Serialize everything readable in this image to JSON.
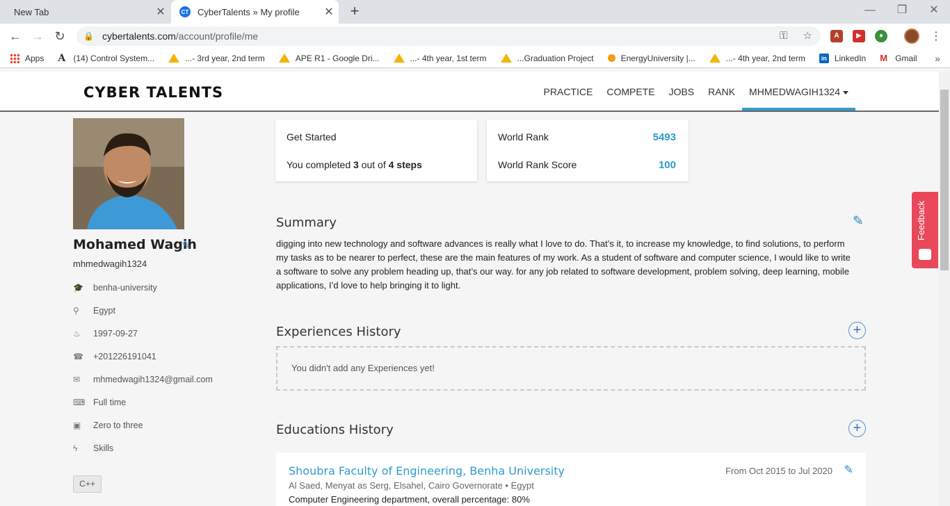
{
  "browser": {
    "tabs": [
      {
        "title": "New Tab"
      },
      {
        "title": "CyberTalents » My profile",
        "favicon": "CT"
      }
    ],
    "url": {
      "host": "cybertalents.com",
      "path": "/account/profile/me"
    },
    "bookmarks": [
      {
        "label": "Apps",
        "icon": "apps-grid-icon"
      },
      {
        "label": "(14) Control System...",
        "icon": "font-icon"
      },
      {
        "label": "...- 3rd year, 2nd term",
        "icon": "drive-icon"
      },
      {
        "label": "APE R1 - Google Dri...",
        "icon": "drive-icon"
      },
      {
        "label": "...- 4th year, 1st term",
        "icon": "drive-icon"
      },
      {
        "label": "...Graduation Project",
        "icon": "drive-icon"
      },
      {
        "label": "EnergyUniversity |...",
        "icon": "energy-icon"
      },
      {
        "label": "...- 4th year, 2nd term",
        "icon": "drive-icon"
      },
      {
        "label": "LinkedIn",
        "icon": "linkedin-icon"
      },
      {
        "label": "Gmail",
        "icon": "gmail-icon"
      }
    ]
  },
  "site": {
    "logo": "CYBER TALENTS",
    "nav": [
      "PRACTICE",
      "COMPETE",
      "JOBS",
      "RANK",
      "MHMEDWAGIH1324"
    ],
    "feedback": "Feedback"
  },
  "profile": {
    "name": "Mohamed Wagih",
    "username": "mhmedwagih1324",
    "info": [
      {
        "icon": "graduation-cap-icon",
        "glyph": "🎓",
        "text": "benha-university"
      },
      {
        "icon": "map-marker-icon",
        "glyph": "⚲",
        "text": "Egypt"
      },
      {
        "icon": "birthday-cake-icon",
        "glyph": "♨",
        "text": "1997-09-27"
      },
      {
        "icon": "phone-icon",
        "glyph": "☎",
        "text": "+201226191041"
      },
      {
        "icon": "envelope-icon",
        "glyph": "✉",
        "text": "mhmedwagih1324@gmail.com"
      },
      {
        "icon": "keyboard-icon",
        "glyph": "⌨",
        "text": "Full time"
      },
      {
        "icon": "briefcase-icon",
        "glyph": "▣",
        "text": "Zero to three"
      },
      {
        "icon": "bolt-icon",
        "glyph": "ϟ",
        "text": "Skills"
      }
    ],
    "skills": [
      "C++"
    ]
  },
  "getting_started": {
    "title": "Get Started",
    "text_prefix": "You completed ",
    "completed": "3",
    "text_mid": " out of ",
    "total": "4 steps"
  },
  "rank": {
    "world_rank_label": "World Rank",
    "world_rank": "5493",
    "score_label": "World Rank Score",
    "score": "100"
  },
  "summary": {
    "title": "Summary",
    "text": "digging into new technology and software advances is really what I love to do. That’s it, to increase my knowledge, to find solutions, to perform my tasks as to be nearer to perfect, these are the main features of my work. As a student of software and computer science, I would like to write a software to solve any problem heading up, that’s our way. for any job related to software development, problem solving, deep learning, mobile applications, I’d love to help bringing it to light."
  },
  "experiences": {
    "title": "Experiences History",
    "empty": "You didn't add any Experiences yet!"
  },
  "educations": {
    "title": "Educations History",
    "items": [
      {
        "school": "Shoubra Faculty of Engineering, Benha University",
        "date": "From Oct 2015 to Jul 2020",
        "location": "Al Saed, Menyat as Serg, Elsahel, Cairo Governorate • Egypt",
        "description": "Computer Engineering department, overall percentage: 80%"
      }
    ]
  },
  "colors": {
    "accent": "#2e9bd0",
    "feedback": "#e8485a"
  }
}
